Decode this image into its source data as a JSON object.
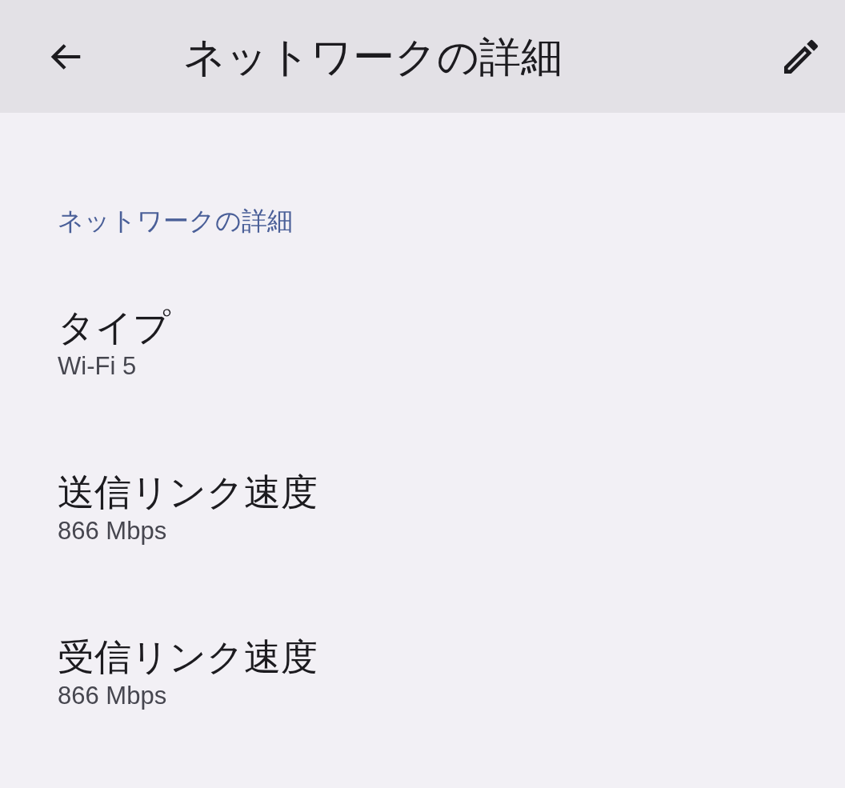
{
  "app_bar": {
    "title": "ネットワークの詳細"
  },
  "section": {
    "header": "ネットワークの詳細",
    "items": [
      {
        "title": "タイプ",
        "value": "Wi-Fi 5"
      },
      {
        "title": "送信リンク速度",
        "value": "866 Mbps"
      },
      {
        "title": "受信リンク速度",
        "value": "866 Mbps"
      }
    ]
  }
}
